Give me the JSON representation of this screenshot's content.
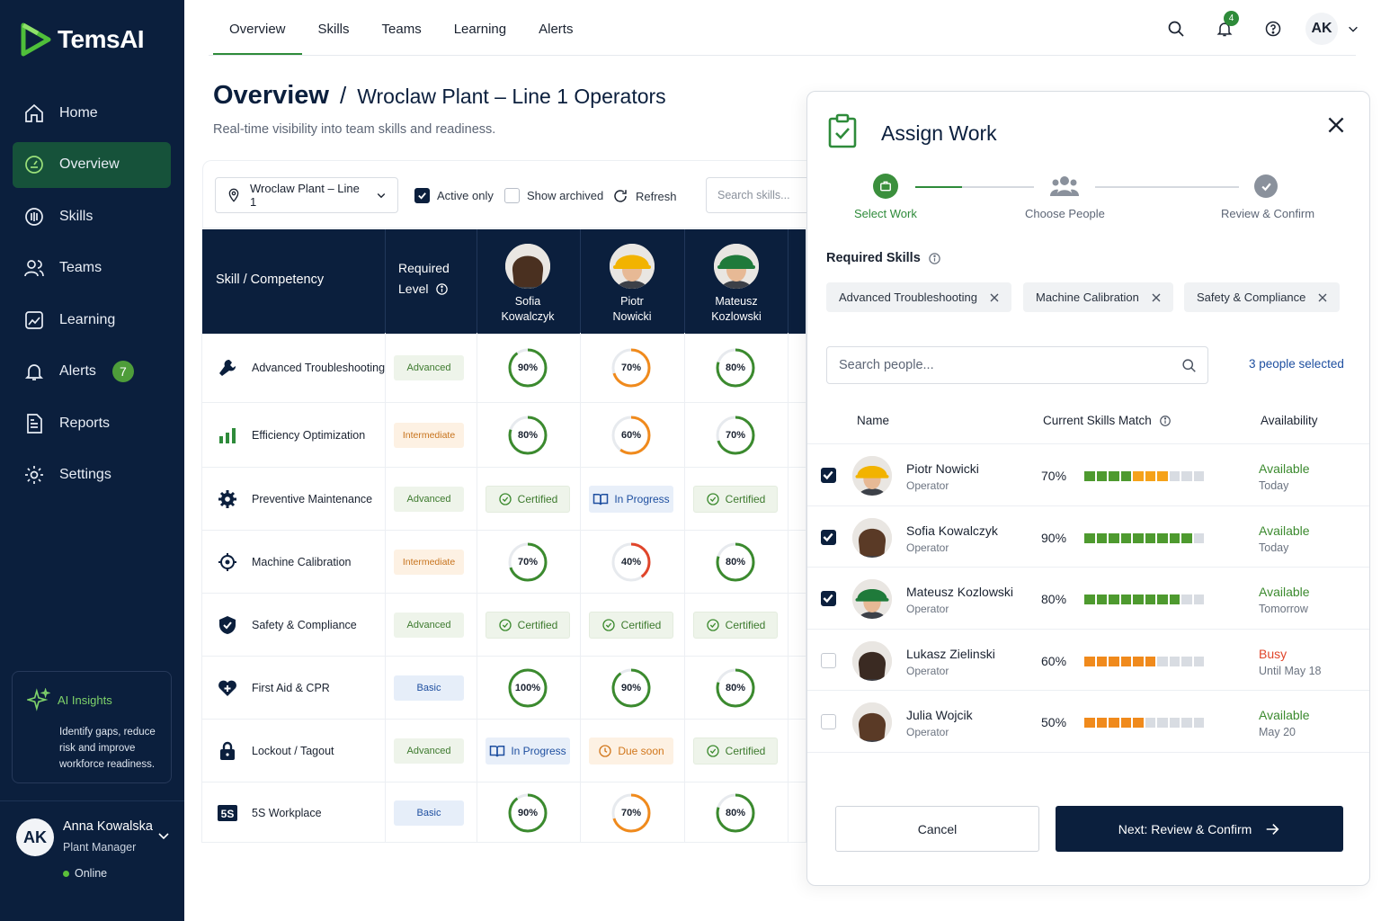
{
  "app": {
    "name": "TemsAI"
  },
  "sidebar": {
    "items": [
      {
        "label": "Home"
      },
      {
        "label": "Overview"
      },
      {
        "label": "Skills"
      },
      {
        "label": "Teams"
      },
      {
        "label": "Learning"
      },
      {
        "label": "Alerts",
        "badge": "7"
      },
      {
        "label": "Reports"
      },
      {
        "label": "Settings"
      }
    ],
    "insights": {
      "title": "AI Insights",
      "text": "Identify gaps, reduce risk and improve workforce readiness."
    },
    "user": {
      "initials": "AK",
      "name": "Anna Kowalska",
      "role": "Plant Manager",
      "status": "Online"
    }
  },
  "topbar": {
    "tabs": [
      "Overview",
      "Skills",
      "Teams",
      "Learning",
      "Alerts"
    ],
    "notif_count": "4",
    "avatar": "AK"
  },
  "header": {
    "title": "Overview",
    "separator": "/",
    "subtitle_title": "Wroclaw Plant – Line 1 Operators",
    "description": "Real-time visibility into team skills and readiness."
  },
  "filters": {
    "site": "Wroclaw Plant – Line 1",
    "active_only": "Active only",
    "show_archived": "Show archived",
    "refresh": "Refresh",
    "search_placeholder": "Search skills..."
  },
  "matrix": {
    "col_skill": "Skill / Competency",
    "col_required_1": "Required",
    "col_required_2": "Level",
    "people": [
      {
        "first": "Sofia",
        "last": "Kowalczyk"
      },
      {
        "first": "Piotr",
        "last": "Nowicki"
      },
      {
        "first": "Mateusz",
        "last": "Kozlowski"
      }
    ],
    "rows": [
      {
        "skill": "Advanced Troubleshooting",
        "icon": "wrench-icon",
        "level": "Advanced",
        "cells": [
          {
            "t": "ring",
            "v": 90,
            "label": "90%"
          },
          {
            "t": "ring",
            "v": 70,
            "label": "70%"
          },
          {
            "t": "ring",
            "v": 80,
            "label": "80%"
          }
        ]
      },
      {
        "skill": "Efficiency Optimization",
        "icon": "bar-chart-icon",
        "level": "Intermediate",
        "cells": [
          {
            "t": "ring",
            "v": 80,
            "label": "80%"
          },
          {
            "t": "ring",
            "v": 60,
            "label": "60%"
          },
          {
            "t": "ring",
            "v": 70,
            "label": "70%"
          }
        ]
      },
      {
        "skill": "Preventive Maintenance",
        "icon": "gear-icon",
        "level": "Advanced",
        "cells": [
          {
            "t": "cert",
            "label": "Certified"
          },
          {
            "t": "prog",
            "label": "In Progress"
          },
          {
            "t": "cert",
            "label": "Certified"
          }
        ]
      },
      {
        "skill": "Machine Calibration",
        "icon": "crosshair-icon",
        "level": "Intermediate",
        "cells": [
          {
            "t": "ring",
            "v": 70,
            "label": "70%"
          },
          {
            "t": "ring",
            "v": 40,
            "label": "40%"
          },
          {
            "t": "ring",
            "v": 80,
            "label": "80%"
          }
        ]
      },
      {
        "skill": "Safety & Compliance",
        "icon": "shield-icon",
        "level": "Advanced",
        "cells": [
          {
            "t": "cert",
            "label": "Certified"
          },
          {
            "t": "cert",
            "label": "Certified"
          },
          {
            "t": "cert",
            "label": "Certified"
          }
        ]
      },
      {
        "skill": "First Aid & CPR",
        "icon": "heart-plus-icon",
        "level": "Basic",
        "cells": [
          {
            "t": "ring",
            "v": 100,
            "label": "100%"
          },
          {
            "t": "ring",
            "v": 90,
            "label": "90%"
          },
          {
            "t": "ring",
            "v": 80,
            "label": "80%"
          }
        ]
      },
      {
        "skill": "Lockout / Tagout",
        "icon": "lock-icon",
        "level": "Advanced",
        "cells": [
          {
            "t": "prog",
            "label": "In Progress"
          },
          {
            "t": "due",
            "label": "Due soon"
          },
          {
            "t": "cert",
            "label": "Certified"
          }
        ]
      },
      {
        "skill": "5S Workplace",
        "icon": "5s-icon",
        "level": "Basic",
        "cells": [
          {
            "t": "ring",
            "v": 90,
            "label": "90%"
          },
          {
            "t": "ring",
            "v": 70,
            "label": "70%"
          },
          {
            "t": "ring",
            "v": 80,
            "label": "80%"
          }
        ]
      }
    ]
  },
  "modal": {
    "title": "Assign Work",
    "steps": [
      "Select Work",
      "Choose People",
      "Review & Confirm"
    ],
    "required_skills": "Required Skills",
    "chips": [
      "Advanced Troubleshooting",
      "Machine Calibration",
      "Safety & Compliance"
    ],
    "search_placeholder": "Search people...",
    "selected": "3 people selected",
    "col_name": "Name",
    "col_match": "Current Skills Match",
    "col_avail": "Availability",
    "people": [
      {
        "name": "Piotr Nowicki",
        "role": "Operator",
        "pct": "70%",
        "checked": true,
        "filled": 7,
        "tone": "mixed",
        "avail": "Available",
        "when": "Today",
        "busy": false
      },
      {
        "name": "Sofia Kowalczyk",
        "role": "Operator",
        "pct": "90%",
        "checked": true,
        "filled": 9,
        "tone": "green",
        "avail": "Available",
        "when": "Today",
        "busy": false
      },
      {
        "name": "Mateusz Kozlowski",
        "role": "Operator",
        "pct": "80%",
        "checked": true,
        "filled": 8,
        "tone": "green",
        "avail": "Available",
        "when": "Tomorrow",
        "busy": false
      },
      {
        "name": "Lukasz Zielinski",
        "role": "Operator",
        "pct": "60%",
        "checked": false,
        "filled": 6,
        "tone": "orange",
        "avail": "Busy",
        "when": "Until May 18",
        "busy": true
      },
      {
        "name": "Julia Wojcik",
        "role": "Operator",
        "pct": "50%",
        "checked": false,
        "filled": 5,
        "tone": "orange",
        "avail": "Available",
        "when": "May 20",
        "busy": false
      }
    ],
    "cancel": "Cancel",
    "next": "Next: Review & Confirm"
  },
  "colors": {
    "navy": "#0b1f3d",
    "green": "#2e8b3a",
    "orange": "#f08a1c",
    "red": "#e0452a",
    "blue": "#1e4fa0"
  }
}
